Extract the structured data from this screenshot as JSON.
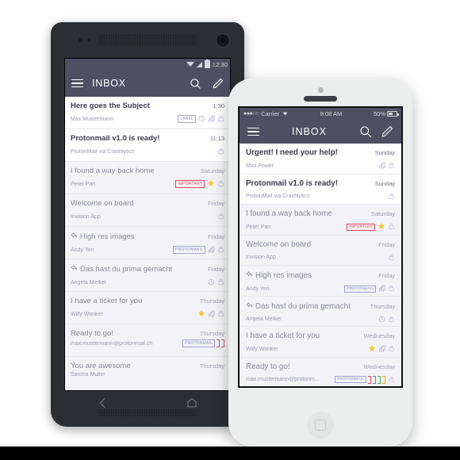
{
  "scene": {
    "description": "Two smartphones side by side showing the ProtonMail INBOX app",
    "colors": {
      "header": "#4F4E63",
      "unread_row": "#FFFFFF",
      "read_row": "#F3F3F7",
      "important_label": "#E8445A",
      "protonmail_label": "#8F8FC4",
      "star": "#F6C948",
      "android_body": "#2B2F33",
      "iphone_body": "#ECEDED",
      "page_background": "#FFFFFF"
    }
  },
  "android": {
    "device_name": "android-phone",
    "statusbar": {
      "time": "12:30",
      "icons": [
        "wifi-triangle-icon",
        "signal-icon",
        "battery-icon"
      ]
    },
    "appbar": {
      "menu_icon": "hamburger-menu-icon",
      "title": "INBOX",
      "search_icon": "search-icon",
      "compose_icon": "compose-pencil-icon"
    },
    "navbar": {
      "back_icon": "back-chevron-icon",
      "home_icon": "home-icon"
    },
    "emails": [
      {
        "subject": "Here goes the Subject",
        "sender": "Max Mustermann",
        "time": "1:30",
        "read": false,
        "reply": false,
        "labels": [
          "LABEL"
        ],
        "label_colors": [],
        "clock": true,
        "attachment": true,
        "star": false,
        "lock": true
      },
      {
        "subject": "Protonmail v1.0 is ready!",
        "sender": "ProtonMail via Crashlytics",
        "time": "11:13",
        "read": false,
        "reply": false,
        "labels": [],
        "label_colors": [],
        "clock": false,
        "attachment": false,
        "star": false,
        "lock": true
      },
      {
        "subject": "I found a way back home",
        "sender": "Peter Pan",
        "time": "Saturday",
        "read": true,
        "reply": false,
        "labels": [
          "IMPORTANT"
        ],
        "label_colors": [],
        "clock": false,
        "attachment": false,
        "star": true,
        "lock": true
      },
      {
        "subject": "Welcome on board",
        "sender": "Invision App",
        "time": "Friday",
        "read": true,
        "reply": false,
        "labels": [],
        "label_colors": [],
        "clock": false,
        "attachment": false,
        "star": false,
        "lock": true
      },
      {
        "subject": "High res images",
        "sender": "Andy Yen",
        "time": "Friday",
        "read": true,
        "reply": true,
        "labels": [
          "PROTONMAIL"
        ],
        "label_colors": [],
        "clock": false,
        "attachment": true,
        "star": false,
        "lock": true
      },
      {
        "subject": "Das hast du prima gemacht",
        "sender": "Angela Merkel",
        "time": "Friday",
        "read": true,
        "reply": true,
        "labels": [],
        "label_colors": [],
        "clock": true,
        "attachment": false,
        "star": false,
        "lock": true
      },
      {
        "subject": "I have a ticket for you",
        "sender": "Willy Wonker",
        "time": "Thursday",
        "read": true,
        "reply": false,
        "labels": [],
        "label_colors": [],
        "clock": false,
        "attachment": true,
        "star": true,
        "lock": true
      },
      {
        "subject": "Ready to go!",
        "sender": "max.mustermann@protonmail.ch",
        "time": "Thursday",
        "read": true,
        "reply": false,
        "labels": [
          "PROTONMAIL"
        ],
        "label_colors": [
          "#E8445A",
          "#E8445A"
        ],
        "clock": false,
        "attachment": false,
        "star": false,
        "lock": false
      },
      {
        "subject": "You are awesome",
        "sender": "Sandra Muller",
        "time": "Thursday",
        "read": true,
        "reply": false,
        "labels": [],
        "label_colors": [],
        "clock": false,
        "attachment": false,
        "star": false,
        "lock": false
      }
    ]
  },
  "iphone": {
    "device_name": "iphone",
    "statusbar": {
      "signal_dots": "●●●○○",
      "carrier": "Carrier",
      "wifi_icon": "wifi-icon",
      "time": "8:08 AM",
      "battery_percent": "50%",
      "battery_icon": "battery-icon"
    },
    "appbar": {
      "menu_icon": "hamburger-menu-icon",
      "title": "INBOX",
      "search_icon": "search-icon",
      "compose_icon": "compose-pencil-icon"
    },
    "home_button": "home-button",
    "emails": [
      {
        "subject": "Urgent! I need your help!",
        "sender": "Max Power",
        "time": "Sunday",
        "read": false,
        "reply": false,
        "labels": [],
        "label_colors": [],
        "clock": false,
        "attachment": true,
        "star": false,
        "lock": true
      },
      {
        "subject": "Protonmail v1.0 is ready!",
        "sender": "ProtonMail via Crashlytics",
        "time": "Sunday",
        "read": false,
        "reply": false,
        "labels": [],
        "label_colors": [],
        "clock": false,
        "attachment": false,
        "star": false,
        "lock": true
      },
      {
        "subject": "I found a way back home",
        "sender": "Peter Pan",
        "time": "Saturday",
        "read": true,
        "reply": false,
        "labels": [
          "IMPORTANT"
        ],
        "label_colors": [],
        "clock": false,
        "attachment": false,
        "star": true,
        "lock": true
      },
      {
        "subject": "Welcome on board",
        "sender": "Invision App",
        "time": "Friday",
        "read": true,
        "reply": false,
        "labels": [],
        "label_colors": [],
        "clock": false,
        "attachment": false,
        "star": false,
        "lock": true
      },
      {
        "subject": "High res images",
        "sender": "Andy Yen",
        "time": "Friday",
        "read": true,
        "reply": true,
        "labels": [
          "PROTONMAIL"
        ],
        "label_colors": [],
        "clock": false,
        "attachment": true,
        "star": false,
        "lock": true
      },
      {
        "subject": "Das hast du prima gemacht",
        "sender": "Angela Merkel",
        "time": "Thursday",
        "read": true,
        "reply": true,
        "labels": [],
        "label_colors": [],
        "clock": true,
        "attachment": false,
        "star": false,
        "lock": true
      },
      {
        "subject": "I have a ticket for you",
        "sender": "Willy Wonker",
        "time": "Wednesday",
        "read": true,
        "reply": false,
        "labels": [],
        "label_colors": [],
        "clock": false,
        "attachment": true,
        "star": true,
        "lock": true
      },
      {
        "subject": "Ready to go!",
        "sender": "max.mustermann@protonm...",
        "time": "Wednesday",
        "read": true,
        "reply": false,
        "labels": [
          "PROTONMAIL"
        ],
        "label_colors": [
          "#E8445A",
          "#5B7FD4",
          "#4CAF50",
          "#F5A623"
        ],
        "clock": false,
        "attachment": false,
        "star": false,
        "lock": true
      }
    ]
  }
}
